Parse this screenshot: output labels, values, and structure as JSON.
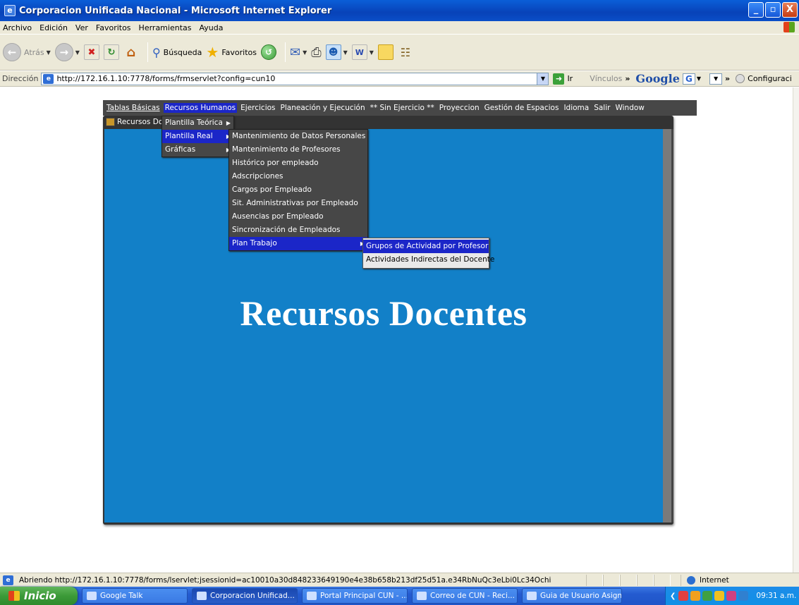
{
  "window": {
    "title": "Corporacion Unificada Nacional - Microsoft Internet Explorer",
    "min": "_",
    "max": "▫",
    "close": "X"
  },
  "menubar": [
    "Archivo",
    "Edición",
    "Ver",
    "Favoritos",
    "Herramientas",
    "Ayuda"
  ],
  "toolbar": {
    "back": "Atrás",
    "search": "Búsqueda",
    "favorites": "Favoritos"
  },
  "addressbar": {
    "label": "Dirección",
    "url": "http://172.16.1.10:7778/forms/frmservlet?config=cun10",
    "go": "Ir",
    "links": "Vínculos",
    "google": "Google",
    "config": "Configuraci"
  },
  "forms": {
    "menu": [
      "Tablas Básicas",
      "Recursos Humanos",
      "Ejercicios",
      "Planeación y Ejecución",
      "** Sin Ejercicio **",
      "Proyeccion",
      "Gestión de Espacios",
      "Idioma",
      "Salir",
      "Window"
    ],
    "window_title": "Recursos Do",
    "big_title": "Recursos Docentes",
    "menu_rrhh": [
      "Plantilla Teórica",
      "Plantilla Real",
      "Gráficas"
    ],
    "menu_plantilla_real": [
      "Mantenimiento de Datos Personales",
      "Mantenimiento de Profesores",
      "Histórico por empleado",
      "Adscripciones",
      "Cargos por Empleado",
      "Sit. Administrativas por Empleado",
      "Ausencias por Empleado",
      "Sincronización de Empleados",
      "Plan Trabajo"
    ],
    "menu_plan_trabajo": [
      "Grupos de Actividad por Profesor",
      "Actividades Indirectas del Docente"
    ]
  },
  "statusbar": {
    "text": "Abriendo http://172.16.1.10:7778/forms/lservlet;jsessionid=ac10010a30d848233649190e4e38b658b213df25d51a.e34RbNuQc3eLbi0Lc34Ochi",
    "zone": "Internet"
  },
  "taskbar": {
    "start": "Inicio",
    "tasks": [
      "Google Talk",
      "Corporacion Unificad...",
      "Portal Principal CUN - ...",
      "Correo de CUN - Reci...",
      "Guia de Usuario Asign..."
    ],
    "clock": "09:31 a.m."
  }
}
